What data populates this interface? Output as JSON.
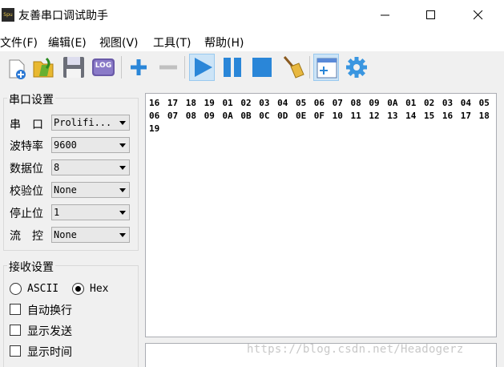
{
  "window": {
    "title": "友善串口调试助手",
    "icon_text": "Spu",
    "controls": [
      "minimize-icon",
      "maximize-icon",
      "close-icon"
    ]
  },
  "menu": [
    "文件(F)",
    "编辑(E)",
    "视图(V)",
    "工具(T)",
    "帮助(H)"
  ],
  "toolbar": {
    "buttons": [
      "new-icon",
      "open-folder-icon",
      "save-icon",
      "log-icon",
      "add-icon",
      "remove-icon",
      "play-icon",
      "pause-icon",
      "stop-icon",
      "broom-icon",
      "window-icon",
      "gear-icon"
    ],
    "log_label": "LOG",
    "active": [
      "play-icon",
      "window-icon"
    ]
  },
  "serial_settings": {
    "title": "串口设置",
    "fields": [
      {
        "label": "串　口",
        "value": "Prolifi..."
      },
      {
        "label": "波特率",
        "value": "9600"
      },
      {
        "label": "数据位",
        "value": "8"
      },
      {
        "label": "校验位",
        "value": "None"
      },
      {
        "label": "停止位",
        "value": "1"
      },
      {
        "label": "流　控",
        "value": "None"
      }
    ]
  },
  "receive_settings": {
    "title": "接收设置",
    "modes": [
      {
        "label": "ASCII",
        "selected": false
      },
      {
        "label": "Hex",
        "selected": true
      }
    ],
    "options": [
      "自动换行",
      "显示发送",
      "显示时间"
    ]
  },
  "receive_data": "16 17 18 19 01 02 03 04 05 06 07 08 09 0A 01 02 03 04 05 06 07 08 09 0A 0B 0C 0D 0E 0F 10 11 12 13 14 15 16 17 18 19",
  "watermark": "https://blog.csdn.net/Headogerz"
}
